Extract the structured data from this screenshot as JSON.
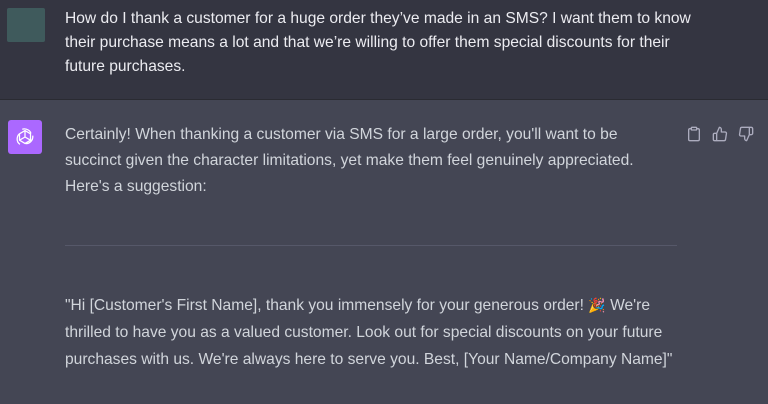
{
  "user_message": {
    "text": "How do I thank a customer for a huge order they’ve made in an SMS? I want them to know their purchase means a lot and that we’re willing to offer them special discounts for their future purchases."
  },
  "assistant_message": {
    "intro": "Certainly! When thanking a customer via SMS for a large order, you'll want to be succinct given the character limitations, yet make them feel genuinely appreciated. Here's a suggestion:",
    "quote_part1": "\"Hi [Customer's First Name], thank you immensely for your generous order! ",
    "quote_emoji": "🎉",
    "quote_part2": " We're thrilled to have you as a valued customer. Look out for special discounts on your future purchases with us. We're always here to serve you. Best, [Your Name/Company Name]\""
  },
  "actions": {
    "copy_icon": "clipboard-icon",
    "like_icon": "thumbs-up-icon",
    "dislike_icon": "thumbs-down-icon"
  },
  "colors": {
    "user_bg": "#343541",
    "assistant_bg": "#444654",
    "avatar_gpt": "#ab68ff",
    "avatar_user": "#3f5a5c"
  }
}
